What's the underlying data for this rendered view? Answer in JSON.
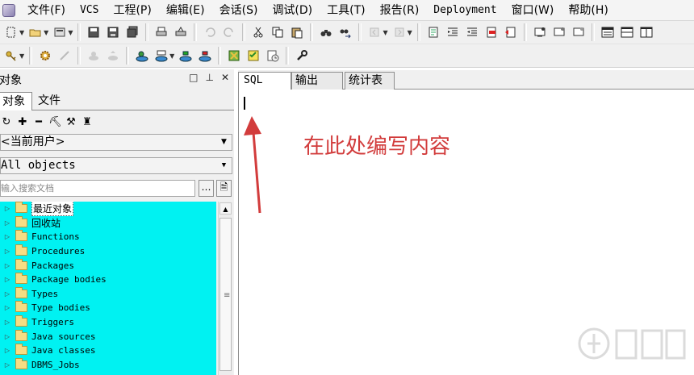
{
  "menubar": {
    "items": [
      "文件(F)",
      "VCS",
      "工程(P)",
      "编辑(E)",
      "会话(S)",
      "调试(D)",
      "工具(T)",
      "报告(R)",
      "Deployment",
      "窗口(W)",
      "帮助(H)"
    ]
  },
  "object_panel": {
    "title": "对象",
    "controls": [
      "□",
      "▫",
      "✕"
    ],
    "tabs": [
      "对象",
      "文件"
    ],
    "user_combo": "<当前用户>",
    "filter_combo": "All objects",
    "search_placeholder": "输入搜索文档",
    "tree_items": [
      "最近对象",
      "回收站",
      "Functions",
      "Procedures",
      "Packages",
      "Package bodies",
      "Types",
      "Type bodies",
      "Triggers",
      "Java sources",
      "Java classes",
      "DBMS_Jobs"
    ]
  },
  "editor": {
    "tabs": [
      "SQL",
      "输出",
      "统计表"
    ],
    "hint": "在此处编写内容"
  },
  "colors": {
    "tree_bg": "#00f2f2",
    "hint_red": "#d23c3c"
  }
}
